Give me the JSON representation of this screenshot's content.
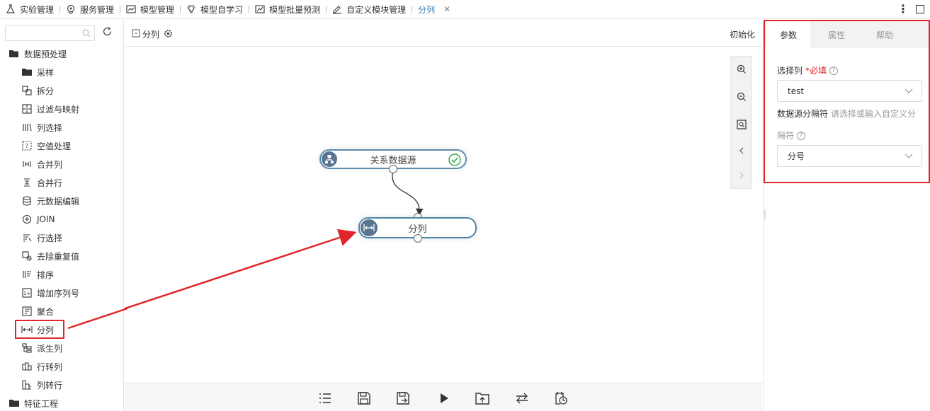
{
  "tabs": [
    {
      "label": "实验管理",
      "icon": "flask-icon"
    },
    {
      "label": "服务管理",
      "icon": "service-icon"
    },
    {
      "label": "模型管理",
      "icon": "model-chart-icon"
    },
    {
      "label": "模型自学习",
      "icon": "bulb-icon"
    },
    {
      "label": "模型批量预测",
      "icon": "line-chart-icon"
    },
    {
      "label": "自定义模块管理",
      "icon": "edit-icon"
    },
    {
      "label": "分列",
      "icon": "",
      "active": true
    }
  ],
  "sidebar": {
    "search_placeholder": "",
    "groups": [
      {
        "label": "数据预处理"
      },
      {
        "label": "特征工程"
      }
    ],
    "items": [
      {
        "label": "采样",
        "icon": "folder-icon"
      },
      {
        "label": "拆分",
        "icon": "split-icon"
      },
      {
        "label": "过滤与映射",
        "icon": "filter-map-icon"
      },
      {
        "label": "列选择",
        "icon": "column-select-icon"
      },
      {
        "label": "空值处理",
        "icon": "null-value-icon"
      },
      {
        "label": "合并列",
        "icon": "merge-columns-icon"
      },
      {
        "label": "合并行",
        "icon": "merge-rows-icon"
      },
      {
        "label": "元数据编辑",
        "icon": "database-icon"
      },
      {
        "label": "JOIN",
        "icon": "join-icon"
      },
      {
        "label": "行选择",
        "icon": "row-select-icon"
      },
      {
        "label": "去除重复值",
        "icon": "dedupe-icon"
      },
      {
        "label": "排序",
        "icon": "sort-icon"
      },
      {
        "label": "增加序列号",
        "icon": "serial-number-icon"
      },
      {
        "label": "聚合",
        "icon": "aggregate-icon"
      },
      {
        "label": "分列",
        "icon": "split-column-icon"
      },
      {
        "label": "派生列",
        "icon": "derived-column-icon"
      },
      {
        "label": "行转列",
        "icon": "row-to-column-icon"
      },
      {
        "label": "列转行",
        "icon": "column-to-row-icon"
      }
    ]
  },
  "canvas": {
    "breadcrumb": "分列",
    "init_label": "初始化",
    "nodes": [
      {
        "label": "关系数据源",
        "icon": "datasource-icon",
        "status": "success"
      },
      {
        "label": "分列",
        "icon": "split-column-icon"
      }
    ]
  },
  "panel": {
    "tabs": [
      "参数",
      "属性",
      "帮助"
    ],
    "select_column_label": "选择列",
    "required_hint": "*必填",
    "select_column_value": "test",
    "separator_label_line1": "数据源分隔符",
    "separator_placeholder": "请选择或输入自定义分",
    "separator_label_line2": "隔符",
    "separator_value": "分号"
  },
  "colors": {
    "node_border": "#5b8db0",
    "highlight_red": "#e0262b",
    "success_green": "#2ea84a"
  }
}
